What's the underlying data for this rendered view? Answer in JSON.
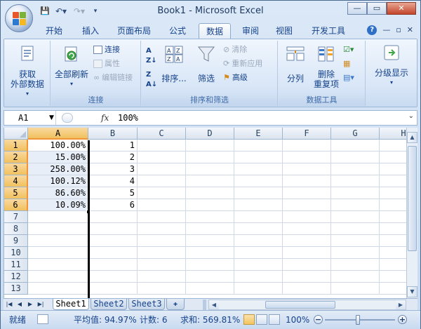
{
  "window": {
    "title": "Book1 - Microsoft Excel",
    "minimize": "—",
    "maximize": "▭",
    "close": "✕"
  },
  "qat": {
    "save": "💾",
    "undo": "↶▾",
    "redo": "↷▾",
    "more": "▾"
  },
  "tabs": [
    {
      "label": "开始"
    },
    {
      "label": "插入"
    },
    {
      "label": "页面布局"
    },
    {
      "label": "公式"
    },
    {
      "label": "数据"
    },
    {
      "label": "审阅"
    },
    {
      "label": "视图"
    },
    {
      "label": "开发工具"
    }
  ],
  "ribbon_right": {
    "help": "?",
    "minimize": "—",
    "restore": "▫",
    "close": "✕"
  },
  "ribbon": {
    "get_external": {
      "line1": "获取",
      "line2": "外部数据"
    },
    "connections_group": {
      "label": "连接",
      "refresh_all": "全部刷新",
      "connections": "连接",
      "properties": "属性",
      "edit_links": "编辑链接"
    },
    "sort_group": {
      "label": "排序和筛选",
      "sort": "排序...",
      "filter": "筛选",
      "clear": "清除",
      "reapply": "重新应用",
      "advanced": "高级"
    },
    "tools_group": {
      "label": "数据工具",
      "text_to_columns": "分列",
      "remove_dup_1": "删除",
      "remove_dup_2": "重复项"
    },
    "outline": {
      "label": "分级显示"
    }
  },
  "formula_bar": {
    "name_box": "A1",
    "fx": "fx",
    "value": "100%"
  },
  "columns": [
    "A",
    "B",
    "C",
    "D",
    "E",
    "F",
    "G",
    "H"
  ],
  "rows": [
    "1",
    "2",
    "3",
    "4",
    "5",
    "6",
    "7",
    "8",
    "9",
    "10",
    "11",
    "12",
    "13"
  ],
  "cells": {
    "A": [
      "100.00%",
      "15.00%",
      "258.00%",
      "100.12%",
      "86.60%",
      "10.09%"
    ],
    "B": [
      "1",
      "2",
      "3",
      "4",
      "5",
      "6"
    ]
  },
  "sheets": [
    "Sheet1",
    "Sheet2",
    "Sheet3"
  ],
  "status": {
    "mode": "就绪",
    "average": "平均值: 94.97%",
    "count": "计数: 6",
    "sum": "求和: 569.81%",
    "zoom": "100%"
  }
}
